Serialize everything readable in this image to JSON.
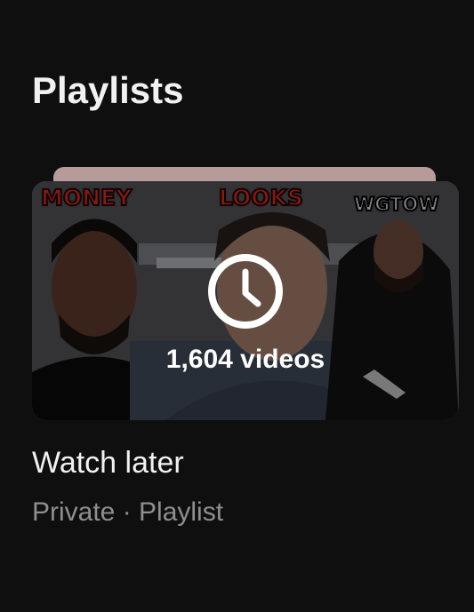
{
  "section": {
    "title": "Playlists"
  },
  "playlist": {
    "title": "Watch later",
    "meta": "Private · Playlist",
    "video_count": "1,604 videos",
    "icon": "clock-icon",
    "thumbnail_words": [
      "MONEY",
      "LOOKS",
      "WGTOW"
    ]
  },
  "colors": {
    "background": "#0f0f0f",
    "primary_text": "#f1f1f1",
    "secondary_text": "#8f8f8f",
    "thumbnail_word_red": "#e8332c"
  }
}
